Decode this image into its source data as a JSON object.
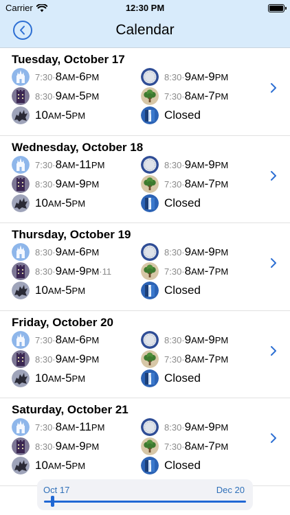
{
  "status_bar": {
    "carrier": "Carrier",
    "time": "12:30 PM"
  },
  "nav": {
    "title": "Calendar"
  },
  "days": [
    {
      "title": "Tuesday, October 17",
      "parks": [
        {
          "icon": "castle-park-icon",
          "early": "7:30·",
          "hours": "8AM-6PM",
          "late": ""
        },
        {
          "icon": "globe-park-icon",
          "early": "8:30·",
          "hours": "9AM-9PM",
          "late": ""
        },
        {
          "icon": "tower-park-icon",
          "early": "8:30·",
          "hours": "9AM-5PM",
          "late": ""
        },
        {
          "icon": "tree-park-icon",
          "early": "7:30·",
          "hours": "8AM-7PM",
          "late": ""
        },
        {
          "icon": "dragon-park-icon",
          "early": "",
          "hours": "10AM-5PM",
          "late": ""
        },
        {
          "icon": "waterfall-park-icon",
          "early": "",
          "hours": "Closed",
          "late": ""
        }
      ]
    },
    {
      "title": "Wednesday, October 18",
      "parks": [
        {
          "icon": "castle-park-icon",
          "early": "7:30·",
          "hours": "8AM-11PM",
          "late": ""
        },
        {
          "icon": "globe-park-icon",
          "early": "8:30·",
          "hours": "9AM-9PM",
          "late": ""
        },
        {
          "icon": "tower-park-icon",
          "early": "8:30·",
          "hours": "9AM-9PM",
          "late": ""
        },
        {
          "icon": "tree-park-icon",
          "early": "7:30·",
          "hours": "8AM-7PM",
          "late": ""
        },
        {
          "icon": "dragon-park-icon",
          "early": "",
          "hours": "10AM-5PM",
          "late": ""
        },
        {
          "icon": "waterfall-park-icon",
          "early": "",
          "hours": "Closed",
          "late": ""
        }
      ]
    },
    {
      "title": "Thursday, October 19",
      "parks": [
        {
          "icon": "castle-park-icon",
          "early": "8:30·",
          "hours": "9AM-6PM",
          "late": ""
        },
        {
          "icon": "globe-park-icon",
          "early": "8:30·",
          "hours": "9AM-9PM",
          "late": ""
        },
        {
          "icon": "tower-park-icon",
          "early": "8:30·",
          "hours": "9AM-9PM",
          "late": "·11"
        },
        {
          "icon": "tree-park-icon",
          "early": "7:30·",
          "hours": "8AM-7PM",
          "late": ""
        },
        {
          "icon": "dragon-park-icon",
          "early": "",
          "hours": "10AM-5PM",
          "late": ""
        },
        {
          "icon": "waterfall-park-icon",
          "early": "",
          "hours": "Closed",
          "late": ""
        }
      ]
    },
    {
      "title": "Friday, October 20",
      "parks": [
        {
          "icon": "castle-park-icon",
          "early": "7:30·",
          "hours": "8AM-6PM",
          "late": ""
        },
        {
          "icon": "globe-park-icon",
          "early": "8:30·",
          "hours": "9AM-9PM",
          "late": ""
        },
        {
          "icon": "tower-park-icon",
          "early": "8:30·",
          "hours": "9AM-9PM",
          "late": ""
        },
        {
          "icon": "tree-park-icon",
          "early": "7:30·",
          "hours": "8AM-7PM",
          "late": ""
        },
        {
          "icon": "dragon-park-icon",
          "early": "",
          "hours": "10AM-5PM",
          "late": ""
        },
        {
          "icon": "waterfall-park-icon",
          "early": "",
          "hours": "Closed",
          "late": ""
        }
      ]
    },
    {
      "title": "Saturday, October 21",
      "parks": [
        {
          "icon": "castle-park-icon",
          "early": "7:30·",
          "hours": "8AM-11PM",
          "late": ""
        },
        {
          "icon": "globe-park-icon",
          "early": "8:30·",
          "hours": "9AM-9PM",
          "late": ""
        },
        {
          "icon": "tower-park-icon",
          "early": "8:30·",
          "hours": "9AM-9PM",
          "late": ""
        },
        {
          "icon": "tree-park-icon",
          "early": "7:30·",
          "hours": "8AM-7PM",
          "late": ""
        },
        {
          "icon": "dragon-park-icon",
          "early": "",
          "hours": "10AM-5PM",
          "late": ""
        },
        {
          "icon": "waterfall-park-icon",
          "early": "",
          "hours": "Closed",
          "late": ""
        }
      ]
    }
  ],
  "slider": {
    "start_label": "Oct 17",
    "end_label": "Dec 20"
  },
  "colors": {
    "accent": "#2067d4",
    "nav_background": "#d8ebfb",
    "secondary_text": "#8a8a8a"
  }
}
